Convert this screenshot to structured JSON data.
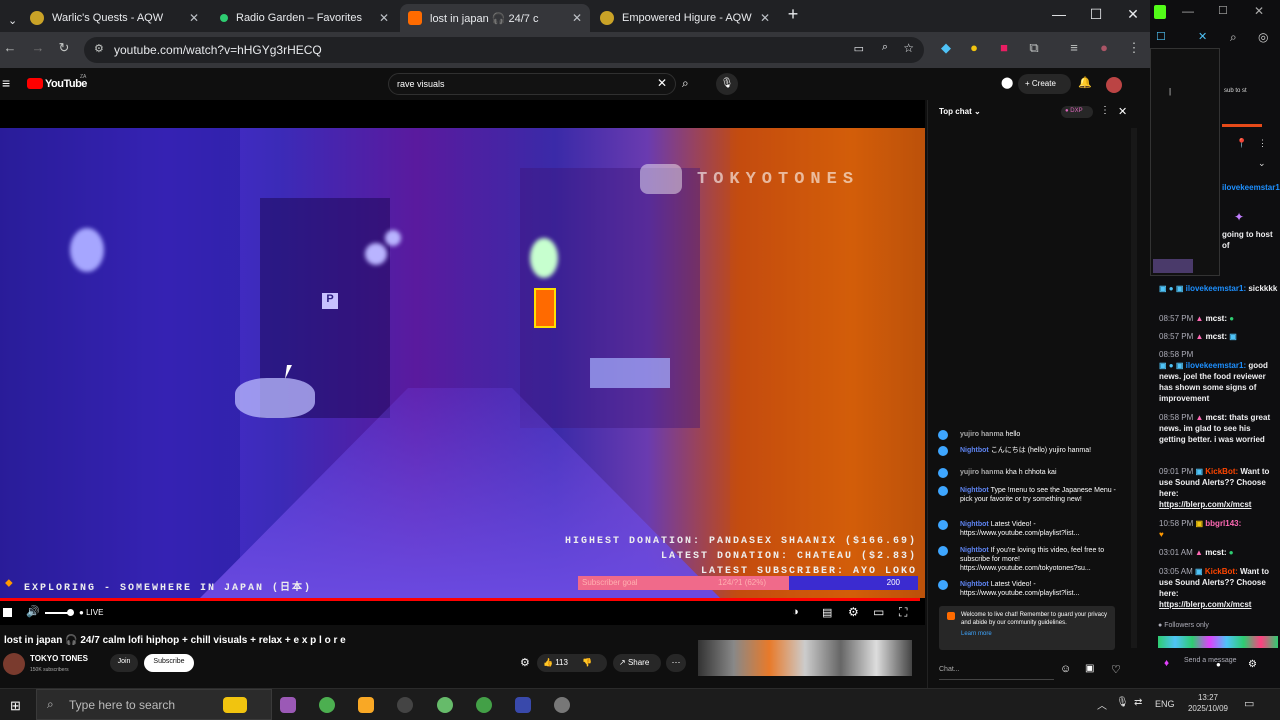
{
  "browser": {
    "tabs": [
      {
        "title": "Warlic's Quests - AQW",
        "color": "#c9a227"
      },
      {
        "title": "Radio Garden – Favorites",
        "color": "#2ecc71"
      },
      {
        "title": "lost in japan 🎧 24/7 c",
        "color": "#ff6b00"
      },
      {
        "title": "Empowered Higure - AQW",
        "color": "#c9a227"
      }
    ],
    "url": "youtube.com/watch?v=hHGYg3rHECQ",
    "new_tab": "+"
  },
  "youtube": {
    "logo": "YouTube",
    "region": "ZA",
    "search_value": "rave visuals",
    "create_label": "Create",
    "video": {
      "channel_overlay": "TOKYOTONES",
      "highest_donation": "HIGHEST DONATION: PANDASEX SHAANIX  ($166.69)",
      "latest_donation": "LATEST DONATION: CHATEAU ($2.83)",
      "latest_subscriber": "LATEST SUBSCRIBER: AYO LOKO",
      "exploring": "EXPLORING - SOMEWHERE IN JAPAN (日本)",
      "goal_label": "Subscriber goal",
      "goal_progress": "124/?1 (62%)",
      "goal_fraction": 0.62,
      "goal_end": "200"
    },
    "live_label": "LIVE",
    "title": "lost in japan 🎧 24/7 calm lofi hiphop + chill visuals + relax + e x p l o r e",
    "channel": "TOKYO TONES",
    "subscribers": "150K subscribers",
    "join_label": "Join",
    "subscribe_label": "Subscribe",
    "likes": "113",
    "share_label": "Share"
  },
  "chat": {
    "header": "Top chat",
    "messages": [
      {
        "name": "yujiro hanma",
        "text": "hello"
      },
      {
        "name": "Nightbot",
        "text": "こんにちは (hello) yujiro hanma!"
      },
      {
        "name": "yujiro hanma",
        "text": "kha h chhota kai"
      },
      {
        "name": "Nightbot",
        "text": "Type !menu to see the Japanese Menu - pick your favorite or try something new!"
      },
      {
        "name": "Nightbot",
        "text": "Latest Video! - https://www.youtube.com/playlist?list..."
      },
      {
        "name": "Nightbot",
        "text": "If you're loving this video, feel free to subscribe for more! https://www.youtube.com/tokyotones?su..."
      },
      {
        "name": "Nightbot",
        "text": "Latest Video! - https://www.youtube.com/playlist?list..."
      }
    ],
    "welcome": "Welcome to live chat! Remember to guard your privacy and abide by our community guidelines.",
    "learn_more": "Learn more",
    "placeholder": "Chat..."
  },
  "twitch": {
    "sub_text": "sub to st",
    "messages": [
      {
        "time": "",
        "user": "ilovekeemstar1:",
        "text": "",
        "color": "#1e90ff"
      },
      {
        "time": "",
        "user": "",
        "text": "going to host of",
        "color": "#ffffff"
      },
      {
        "time": "",
        "user": "ilovekeemstar1:",
        "text": "sickkkk",
        "color": "#1e90ff"
      },
      {
        "time": "08:57 PM",
        "user": "mcst:",
        "text": "",
        "color": "#ff69b4"
      },
      {
        "time": "08:57 PM",
        "user": "mcst:",
        "text": "",
        "color": "#ff69b4"
      },
      {
        "time": "08:58 PM",
        "user": "ilovekeemstar1:",
        "text": "good news. joel the food reviewer has shown some signs of improvement",
        "color": "#1e90ff"
      },
      {
        "time": "08:58 PM",
        "user": "mcst:",
        "text": "thats great news. im glad to see his getting better. i was worried",
        "color": "#ff69b4"
      },
      {
        "time": "09:01 PM",
        "user": "KickBot:",
        "text": "Want to use Sound Alerts?? Choose here:",
        "link": "https://blerp.com/x/mcst",
        "color": "#ff4500"
      },
      {
        "time": "10:58 PM",
        "user": "bbgrl143:",
        "text": "",
        "color": "#ff69b4"
      },
      {
        "time": "03:01 AM",
        "user": "mcst:",
        "text": "",
        "color": "#ff69b4"
      },
      {
        "time": "03:05 AM",
        "user": "KickBot:",
        "text": "Want to use Sound Alerts?? Choose here:",
        "link": "https://blerp.com/x/mcst",
        "color": "#ff4500"
      }
    ],
    "followers_only": "Followers only",
    "send_placeholder": "Send a message"
  },
  "taskbar": {
    "search_placeholder": "Type here to search",
    "lang": "ENG",
    "time": "13:27",
    "date": "2025/10/09"
  }
}
